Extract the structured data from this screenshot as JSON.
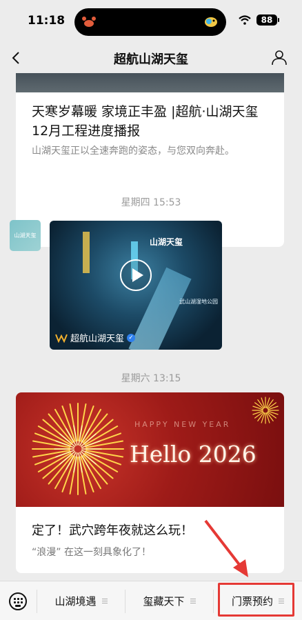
{
  "status_bar": {
    "time": "11:18",
    "battery": "88"
  },
  "nav": {
    "title": "超航山湖天玺"
  },
  "feed": {
    "article1": {
      "title": "天寒岁幕暖 家境正丰盈 |超航·山湖天玺12月工程进度播报",
      "description": "山湖天玺正以全速奔跑的姿态，与您双向奔赴。"
    },
    "timestamp1": "星期四 15:53",
    "video": {
      "brand_overlay": "山湖天玺",
      "sign_text": "武山湖湿地公园",
      "account_name": "超航山湖天玺",
      "avatar_text": "山湖天玺"
    },
    "timestamp2": "星期六 13:15",
    "article2": {
      "banner_small": "HAPPY NEW YEAR",
      "banner_big": "Hello 2026",
      "title": "定了！武穴跨年夜就这么玩！",
      "description": "“浪漫” 在这一刻具象化了！"
    }
  },
  "bottom_menu": {
    "items": [
      {
        "label": "山湖境遇"
      },
      {
        "label": "玺藏天下"
      },
      {
        "label": "门票预约"
      }
    ]
  },
  "colors": {
    "highlight": "#e53935",
    "verified": "#2f80ed"
  }
}
